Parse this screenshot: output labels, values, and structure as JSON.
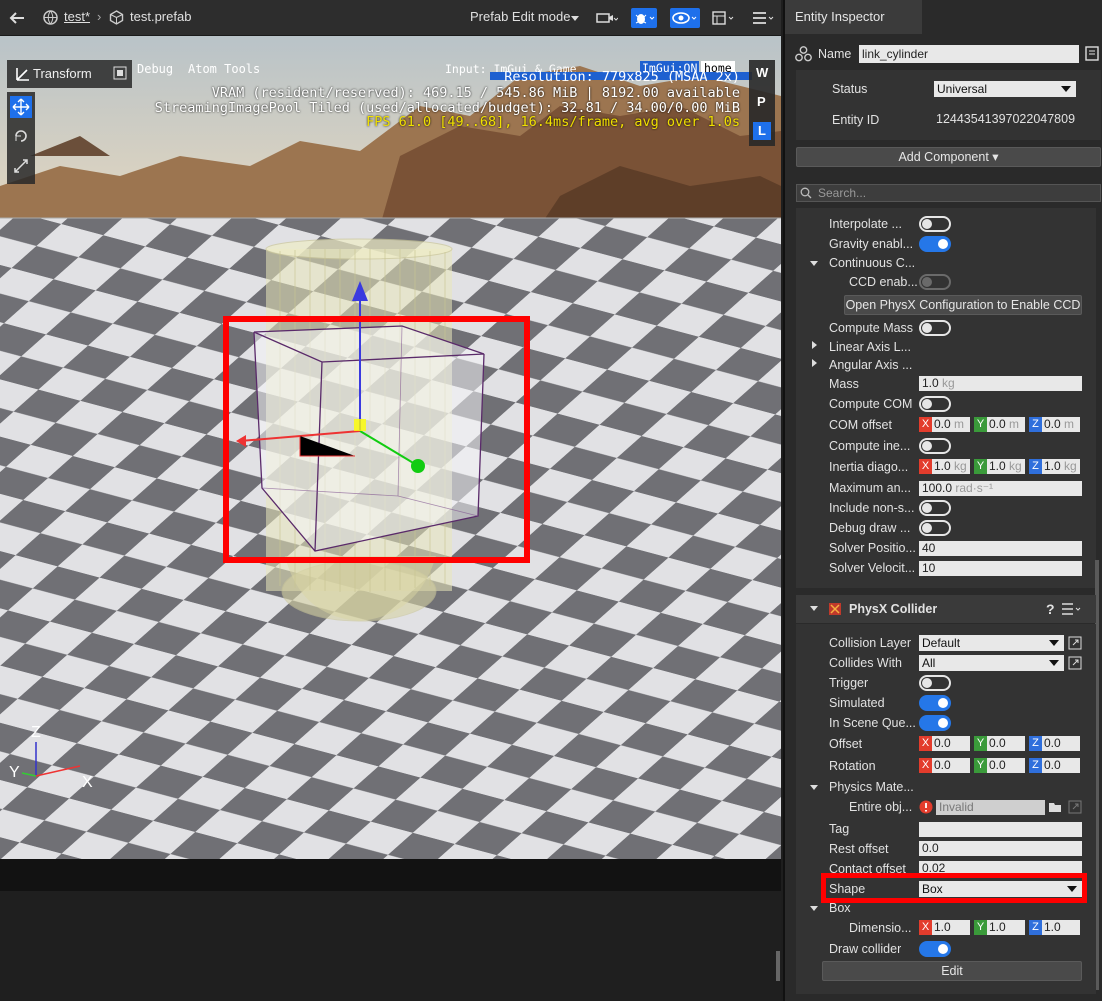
{
  "toolbar": {
    "breadcrumb_level": "test*",
    "breadcrumb_sep": "›",
    "prefab_name": "test.prefab",
    "mode": "Prefab Edit mode"
  },
  "viewport": {
    "transform_label": "Transform",
    "menu_debug": "Debug",
    "menu_atom_tools": "Atom Tools",
    "input_label": "Input: ImGui & Game",
    "imgui_on": "ImGui:ON",
    "imgui_home": "home",
    "stats": [
      "Resolution: 779x825 (MSAA 2x)",
      "VRAM (resident/reserved): 469.15 / 545.86 MiB | 8192.00 available",
      "StreamingImagePool Tiled (used/allocated/budget): 32.81 / 34.00/0.00 MiB",
      "FPS 61.0 [49..68], 16.4ms/frame, avg over 1.0s"
    ],
    "side_buttons": [
      "W",
      "P",
      "L"
    ],
    "axis_z": "Z",
    "axis_y": "Y",
    "axis_x": "X"
  },
  "inspector": {
    "tab_title": "Entity Inspector",
    "name_label": "Name",
    "name_value": "link_cylinder",
    "status_label": "Status",
    "status_value": "Universal",
    "entity_id_label": "Entity ID",
    "entity_id_value": "12443541397022047809",
    "add_component": "Add Component ▾",
    "search_placeholder": "Search...",
    "rigidbody": {
      "interpolate": "Interpolate ...",
      "gravity": "Gravity enabl...",
      "continuous": "Continuous C...",
      "ccd_enab": "CCD enab...",
      "open_physx_btn": "Open PhysX Configuration to Enable CCD",
      "compute_mass": "Compute Mass",
      "linear_axis": "Linear Axis L...",
      "angular_axis": "Angular Axis ...",
      "mass_label": "Mass",
      "mass_value": "1.0",
      "mass_unit": "kg",
      "compute_com": "Compute COM",
      "com_offset": "COM offset",
      "com_x": "0.0",
      "com_y": "0.0",
      "com_z": "0.0",
      "com_unit": "m",
      "compute_inertia": "Compute ine...",
      "inertia_diag": "Inertia diago...",
      "in_x": "1.0",
      "in_y": "1.0",
      "in_z": "1.0",
      "in_unit": "kg",
      "max_ang": "Maximum an...",
      "max_ang_value": "100.0",
      "max_ang_unit": "rad·s⁻¹",
      "include_non": "Include non-s...",
      "debug_draw": "Debug draw ...",
      "solver_pos": "Solver Positio...",
      "solver_pos_value": "40",
      "solver_vel": "Solver Velocit...",
      "solver_vel_value": "10"
    },
    "collider": {
      "title": "PhysX Collider",
      "help": "?",
      "collision_layer": "Collision Layer",
      "collision_layer_value": "Default",
      "collides_with": "Collides With",
      "collides_with_value": "All",
      "trigger": "Trigger",
      "simulated": "Simulated",
      "in_scene": "In Scene Que...",
      "offset": "Offset",
      "off_x": "0.0",
      "off_y": "0.0",
      "off_z": "0.0",
      "rotation": "Rotation",
      "rot_x": "0.0",
      "rot_y": "0.0",
      "rot_z": "0.0",
      "physics_mat": "Physics Mate...",
      "entire_obj": "Entire obj...",
      "entire_obj_value": "Invalid",
      "tag": "Tag",
      "rest_offset": "Rest offset",
      "rest_offset_value": "0.0",
      "contact_offset": "Contact offset",
      "contact_offset_value": "0.02",
      "shape": "Shape",
      "shape_value": "Box",
      "box": "Box",
      "dimensions": "Dimensio...",
      "dim_x": "1.0",
      "dim_y": "1.0",
      "dim_z": "1.0",
      "draw_collider": "Draw collider",
      "edit_btn": "Edit"
    }
  },
  "colors": {
    "highlight": "#ff0000",
    "toggle_on": "#2577e8",
    "fps_text": "#f0e000"
  }
}
